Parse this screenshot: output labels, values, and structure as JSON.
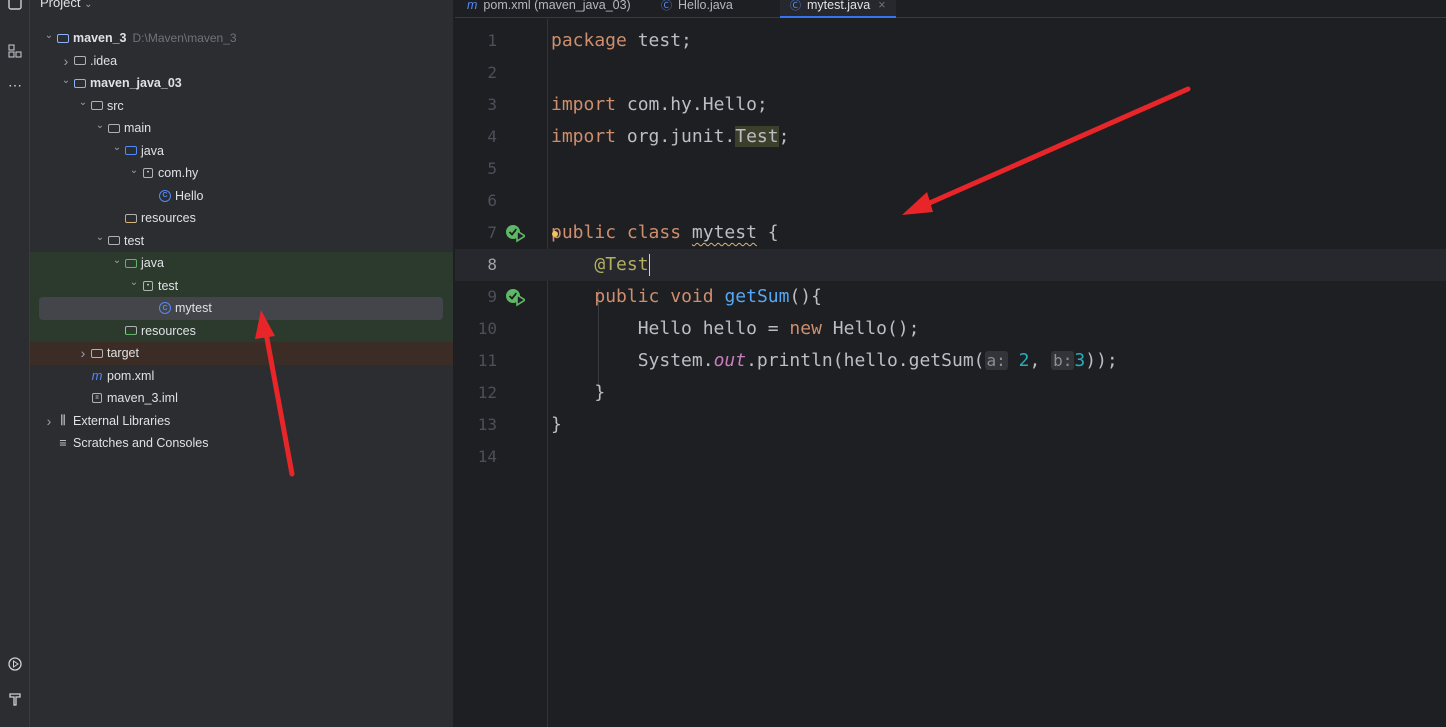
{
  "project_panel": {
    "title": "Project",
    "tree": [
      {
        "label": "maven_3",
        "path": "D:\\Maven\\maven_3",
        "indent": 0,
        "expanded": true,
        "icon": "module-folder-icon",
        "bold": true
      },
      {
        "label": ".idea",
        "indent": 1,
        "expanded": false,
        "icon": "folder-icon"
      },
      {
        "label": "maven_java_03",
        "indent": 1,
        "expanded": true,
        "icon": "module-folder-icon",
        "bold": true
      },
      {
        "label": "src",
        "indent": 2,
        "expanded": true,
        "icon": "folder-icon"
      },
      {
        "label": "main",
        "indent": 3,
        "expanded": true,
        "icon": "folder-icon"
      },
      {
        "label": "java",
        "indent": 4,
        "expanded": true,
        "icon": "source-folder-icon"
      },
      {
        "label": "com.hy",
        "indent": 5,
        "expanded": true,
        "icon": "package-icon"
      },
      {
        "label": "Hello",
        "indent": 6,
        "icon": "class-icon"
      },
      {
        "label": "resources",
        "indent": 4,
        "icon": "resources-folder-icon"
      },
      {
        "label": "test",
        "indent": 3,
        "expanded": true,
        "icon": "folder-icon"
      },
      {
        "label": "java",
        "indent": 4,
        "expanded": true,
        "icon": "test-source-folder-icon"
      },
      {
        "label": "test",
        "indent": 5,
        "expanded": true,
        "icon": "package-icon"
      },
      {
        "label": "mytest",
        "indent": 6,
        "icon": "class-icon",
        "selected": true
      },
      {
        "label": "resources",
        "indent": 4,
        "icon": "test-resources-folder-icon"
      },
      {
        "label": "target",
        "indent": 2,
        "expanded": false,
        "icon": "folder-icon"
      },
      {
        "label": "pom.xml",
        "indent": 2,
        "icon": "maven-icon"
      },
      {
        "label": "maven_3.iml",
        "indent": 2,
        "icon": "iml-file-icon"
      },
      {
        "label": "External Libraries",
        "indent": 0,
        "expanded": false,
        "icon": "library-icon"
      },
      {
        "label": "Scratches and Consoles",
        "indent": 0,
        "icon": "scratches-icon"
      }
    ]
  },
  "tabs": [
    {
      "label": "pom.xml (maven_java_03)",
      "icon": "maven-icon"
    },
    {
      "label": "Hello.java",
      "icon": "class-icon"
    },
    {
      "label": "mytest.java",
      "icon": "class-icon",
      "active": true
    }
  ],
  "editor": {
    "current_line": 8,
    "lines": [
      "package test;",
      "",
      "import com.hy.Hello;",
      "import org.junit.Test;",
      "",
      "",
      "public class mytest {",
      "    @Test",
      "    public void getSum(){",
      "        Hello hello = new Hello();",
      "        System.out.println(hello.getSum( a: 2, b: 3));",
      "    }",
      "}",
      ""
    ],
    "line_numbers": [
      "1",
      "2",
      "3",
      "4",
      "5",
      "6",
      "7",
      "8",
      "9",
      "10",
      "11",
      "12",
      "13",
      "14"
    ]
  },
  "colors": {
    "accent": "#3574f0",
    "annotation_arrow": "#e8262a",
    "keyword": "#cf8e6d",
    "method": "#56a8f5",
    "number": "#2aacb8"
  }
}
